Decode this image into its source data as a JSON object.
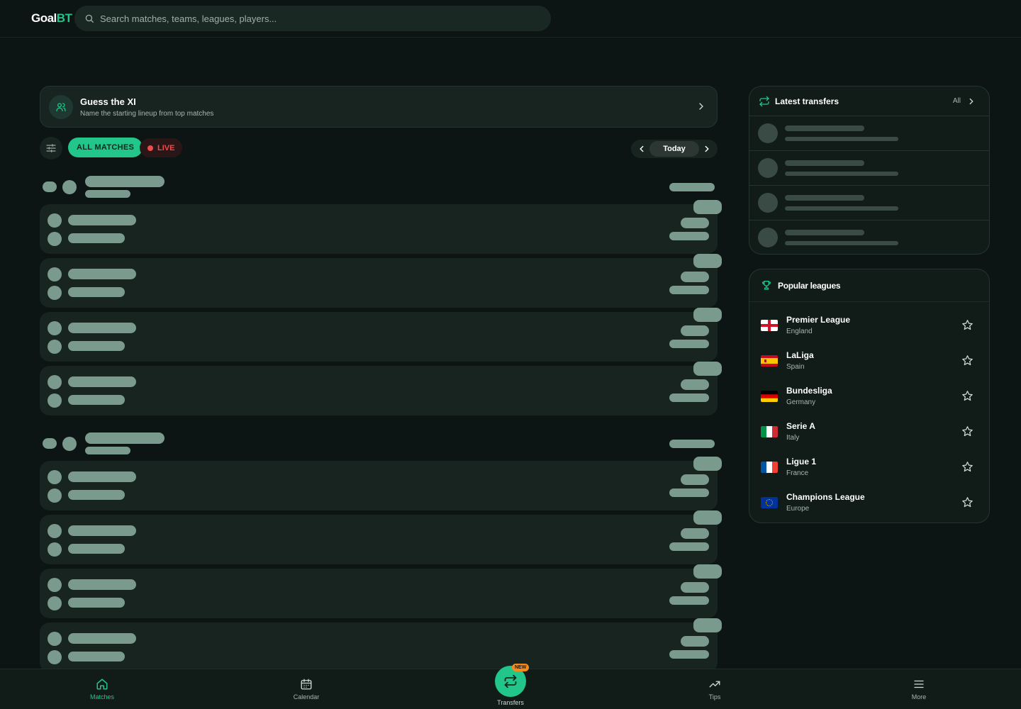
{
  "app": {
    "logo_part1": "Goal",
    "logo_part2": "BT",
    "search_placeholder": "Search matches, teams, leagues, players..."
  },
  "guess_card": {
    "title": "Guess the XI",
    "subtitle": "Name the starting lineup from top matches"
  },
  "filters": {
    "all_matches": "ALL MATCHES",
    "live": "LIVE",
    "date_label": "Today"
  },
  "transfers": {
    "title": "Latest transfers",
    "all_link": "All"
  },
  "popular_leagues": {
    "title": "Popular leagues",
    "items": [
      {
        "name": "Premier League",
        "country": "England"
      },
      {
        "name": "LaLiga",
        "country": "Spain"
      },
      {
        "name": "Bundesliga",
        "country": "Germany"
      },
      {
        "name": "Serie A",
        "country": "Italy"
      },
      {
        "name": "Ligue 1",
        "country": "France"
      },
      {
        "name": "Champions League",
        "country": "Europe"
      }
    ]
  },
  "bottom_nav": {
    "matches": "Matches",
    "calendar": "Calendar",
    "transfers": "Transfers",
    "new_badge": "NEW",
    "tips": "Tips",
    "more": "More"
  },
  "colors": {
    "accent": "#22c58a",
    "live": "#ef4b4b",
    "badge": "#f28c1e",
    "background": "#0c1513",
    "card": "#172420",
    "skeleton": "#7a9a8e"
  }
}
